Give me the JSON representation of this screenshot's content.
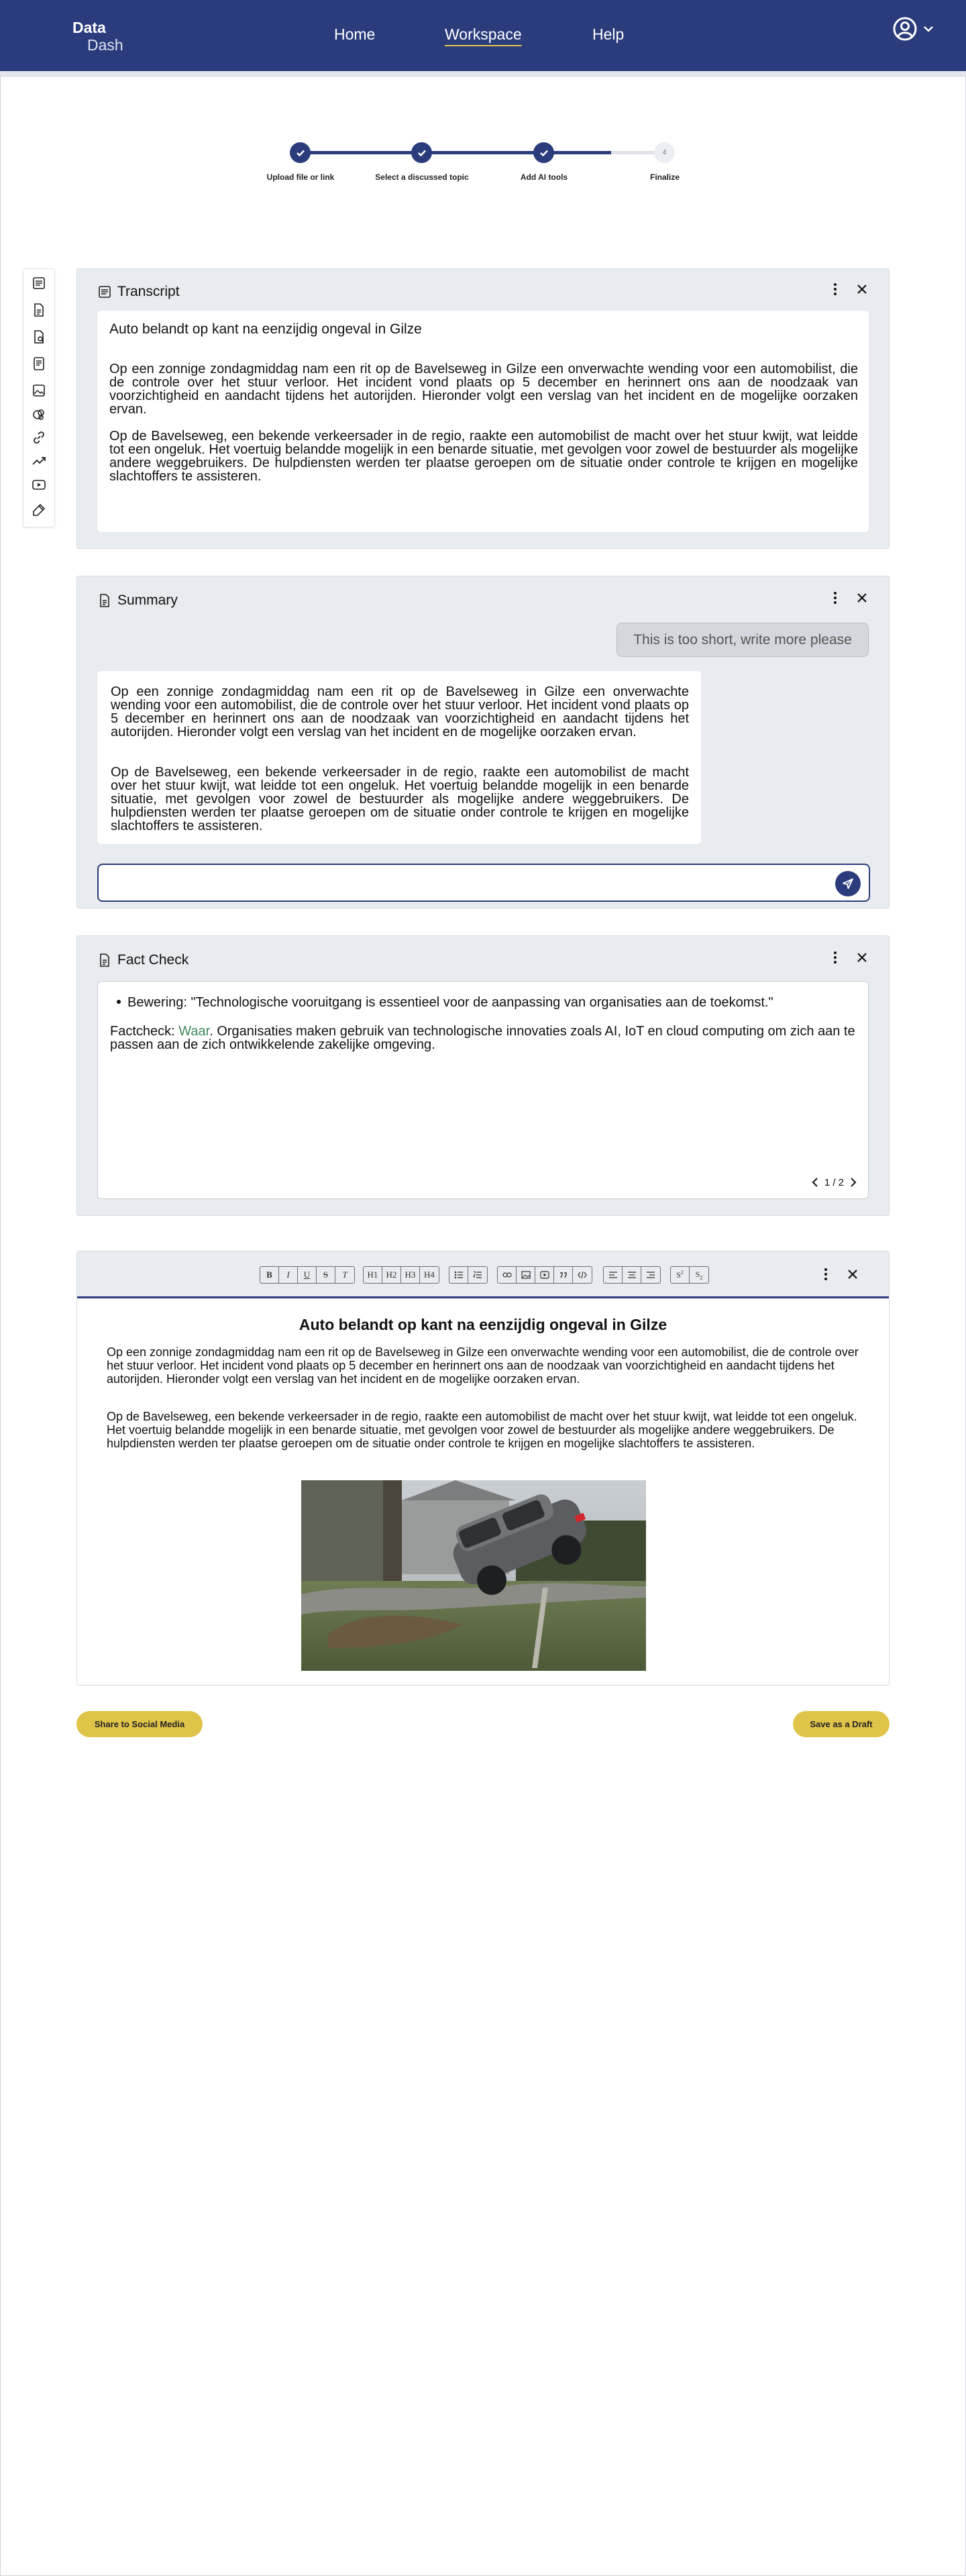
{
  "header": {
    "logo_line1": "Data",
    "logo_line2": "Dash",
    "nav": [
      "Home",
      "Workspace",
      "Help"
    ],
    "active_nav": "Workspace"
  },
  "stepper": {
    "steps": [
      {
        "label": "Upload file or link",
        "state": "done"
      },
      {
        "label": "Select a discussed topic",
        "state": "done"
      },
      {
        "label": "Add AI tools",
        "state": "done"
      },
      {
        "label": "Finalize",
        "state": "pending",
        "number": "4"
      }
    ],
    "progress": 0.85
  },
  "sidebar": {
    "icons": [
      "transcript-icon",
      "document-icon",
      "file-search-icon",
      "notes-icon",
      "image-icon",
      "ai-brain-icon",
      "link-icon",
      "trend-icon",
      "video-icon",
      "edit-icon"
    ]
  },
  "transcript": {
    "title": "Transcript",
    "headline": "Auto belandt op kant na eenzijdig ongeval in Gilze",
    "p1": "Op een zonnige zondagmiddag nam een rit op de Bavelseweg in Gilze een onverwachte wending voor een automobilist, die de controle over het stuur verloor. Het incident vond plaats op 5 december en herinnert ons aan de noodzaak van voorzichtigheid en aandacht tijdens het autorijden. Hieronder volgt een verslag van het incident en de mogelijke oorzaken ervan.",
    "p2": "Op de Bavelseweg, een bekende verkeersader in de regio, raakte een automobilist de macht over het stuur kwijt, wat leidde tot een ongeluk. Het voertuig belandde mogelijk in een benarde situatie, met gevolgen voor zowel de bestuurder als mogelijke andere weggebruikers. De hulpdiensten werden ter plaatse geroepen om de situatie onder controle te krijgen en mogelijke slachtoffers te assisteren."
  },
  "summary": {
    "title": "Summary",
    "user_message": "This is too short, write more please",
    "p1": "Op een zonnige zondagmiddag nam een rit op de Bavelseweg in Gilze een onverwachte wending voor een automobilist, die de controle over het stuur verloor. Het incident vond plaats op 5 december en herinnert ons aan de noodzaak van voorzichtigheid en aandacht tijdens het autorijden. Hieronder volgt een verslag van het incident en de mogelijke oorzaken ervan.",
    "p2": "Op de Bavelseweg, een bekende verkeersader in de regio, raakte een automobilist de macht over het stuur kwijt, wat leidde tot een ongeluk. Het voertuig belandde mogelijk in een benarde situatie, met gevolgen voor zowel de bestuurder als mogelijke andere weggebruikers. De hulpdiensten werden ter plaatse geroepen om de situatie onder controle te krijgen en mogelijke slachtoffers te assisteren.",
    "input_value": ""
  },
  "factcheck": {
    "title": "Fact Check",
    "claim": "Bewering: \"Technologische vooruitgang is essentieel voor de aanpassing van organisaties aan de toekomst.\"",
    "label": "Factcheck: ",
    "verdict": "Waar",
    "explanation": ". Organisaties maken gebruik van technologische innovaties zoals AI, IoT en cloud computing om zich aan te passen aan de zich ontwikkelende zakelijke omgeving.",
    "page": "1 / 2",
    "verdict_color": "#3f8a5c"
  },
  "editor": {
    "toolbar_groups": [
      [
        "B",
        "I",
        "U",
        "S",
        "T"
      ],
      [
        "H1",
        "H2",
        "H3",
        "H4"
      ],
      [
        "bullet-list",
        "numbered-list"
      ],
      [
        "link",
        "image",
        "video",
        "quote",
        "code"
      ],
      [
        "align-left",
        "align-center",
        "align-right"
      ],
      [
        "superscript",
        "subscript"
      ]
    ],
    "title": "Auto belandt op kant na eenzijdig ongeval in Gilze",
    "p1": "Op een zonnige zondagmiddag nam een rit op de Bavelseweg in Gilze een onverwachte wending voor een automobilist, die de controle over het stuur verloor. Het incident vond plaats op 5 december en herinnert ons aan de noodzaak van voorzichtigheid en aandacht tijdens het autorijden. Hieronder volgt een verslag van het incident en de mogelijke oorzaken ervan.",
    "p2": "Op de Bavelseweg, een bekende verkeersader in de regio, raakte een automobilist de macht over het stuur kwijt, wat leidde tot een ongeluk. Het voertuig belandde mogelijk in een benarde situatie, met gevolgen voor zowel de bestuurder als mogelijke andere weggebruikers. De hulpdiensten werden ter plaatse geroepen om de situatie onder controle te krijgen en mogelijke slachtoffers te assisteren."
  },
  "actions": {
    "share": "Share to Social Media",
    "draft": "Save as a Draft"
  },
  "colors": {
    "brand": "#2a3c7c",
    "accent": "#e0c44a"
  }
}
